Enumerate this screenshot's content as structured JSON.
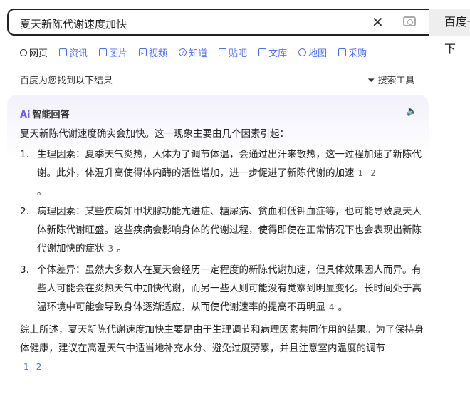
{
  "search": {
    "query": "夏天新陈代谢速度加快",
    "button": "百度一下"
  },
  "tabs": [
    {
      "label": "网页",
      "icon": "search-icon"
    },
    {
      "label": "资讯",
      "icon": "news-icon"
    },
    {
      "label": "图片",
      "icon": "image-icon"
    },
    {
      "label": "视频",
      "icon": "video-icon"
    },
    {
      "label": "知道",
      "icon": "question-icon"
    },
    {
      "label": "贴吧",
      "icon": "tieba-icon"
    },
    {
      "label": "文库",
      "icon": "doc-icon"
    },
    {
      "label": "地图",
      "icon": "map-icon"
    },
    {
      "label": "采购",
      "icon": "basket-icon"
    }
  ],
  "results_text": "百度为您找到以下结果",
  "search_tools": "搜索工具",
  "ai": {
    "logo": "Ai",
    "title": "智能回答",
    "intro": "夏天新陈代谢速度确实会加快。这一现象主要由几个因素引起：",
    "items": [
      {
        "num": "1.",
        "text": "生理因素：夏季天气炎热，人体为了调节体温，会通过出汗来散热，这一过程加速了新陈代谢。此外，体温升高使得体内酶的活性增加，进一步促进了新陈代谢的加速",
        "cites": [
          "1",
          "2"
        ],
        "end": "。"
      },
      {
        "num": "2.",
        "text": "病理因素：某些疾病如甲状腺功能亢进症、糖尿病、贫血和低钾血症等，也可能导致夏天人体新陈代谢旺盛。这些疾病会影响身体的代谢过程，使得即使在正常情况下也会表现出新陈代谢加快的症状",
        "cites": [
          "3"
        ],
        "end": "。"
      },
      {
        "num": "3.",
        "text": "个体差异：虽然大多数人在夏天会经历一定程度的新陈代谢加速，但具体效果因人而异。有些人可能会在炎热天气中加快代谢，而另一些人则可能没有觉察到明显变化。长时间处于高温环境中可能会导致身体逐渐适应，从而使代谢速率的提高不再明显",
        "cites": [
          "4"
        ],
        "end": "。"
      }
    ],
    "summary": "综上所述，夏天新陈代谢速度加快主要是由于生理调节和病理因素共同作用的结果。为了保持身体健康，建议在高温天气中适当地补充水分、避免过度劳累，并且注意室内温度的调节",
    "summary_cites": [
      "1",
      "2"
    ],
    "summary_end": "。"
  }
}
